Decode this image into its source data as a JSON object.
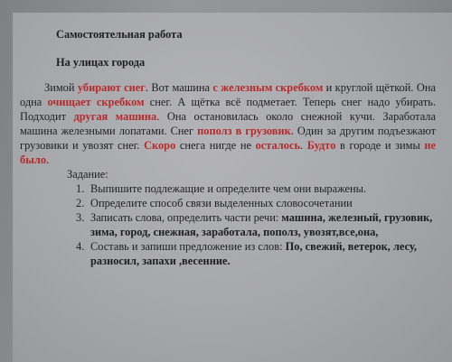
{
  "title": "Самостоятельная работа",
  "subtitle": "На улицах города",
  "paragraph": [
    {
      "t": "Зимой "
    },
    {
      "t": "убирают снег",
      "c": "red"
    },
    {
      "t": ". Вот машина "
    },
    {
      "t": "с железным скребком",
      "c": "red"
    },
    {
      "t": " и круглой щёткой. Она одна "
    },
    {
      "t": "очищает скребком",
      "c": "red"
    },
    {
      "t": " снег. А щётка всё подметает. Теперь снег надо убирать. Подходит "
    },
    {
      "t": "другая машина",
      "c": "red"
    },
    {
      "t": ". Она остановилась около снежной кучи. Заработала машина железными лопатами. Снег "
    },
    {
      "t": "пополз в грузовик",
      "c": "red"
    },
    {
      "t": ". Один за другим подъезжают грузовики и увозят снег. "
    },
    {
      "t": "Скоро",
      "c": "red"
    },
    {
      "t": " снега нигде не "
    },
    {
      "t": "осталось",
      "c": "red"
    },
    {
      "t": ". "
    },
    {
      "t": "Будто",
      "c": "red"
    },
    {
      "t": " в городе и зимы "
    },
    {
      "t": "не было",
      "c": "red"
    },
    {
      "t": "."
    }
  ],
  "task_title": "Задание:",
  "tasks": [
    {
      "num": "1.",
      "text": "Выпишите подлежащие и определите чем они выражены."
    },
    {
      "num": "2.",
      "text": "Определите способ связи выделенных словосочетании"
    },
    {
      "num": "3.",
      "text": "Записать слова, определить части речи: ",
      "bold": "машина, железный, грузовик, зима, город, снежная, заработала, пополз, увозят,все,она,"
    },
    {
      "num": "4.",
      "text": "Составь и запиши предложение из слов: ",
      "bold": "По, свежий, ветерок, лесу, разносил, запахи ,весенние."
    }
  ]
}
